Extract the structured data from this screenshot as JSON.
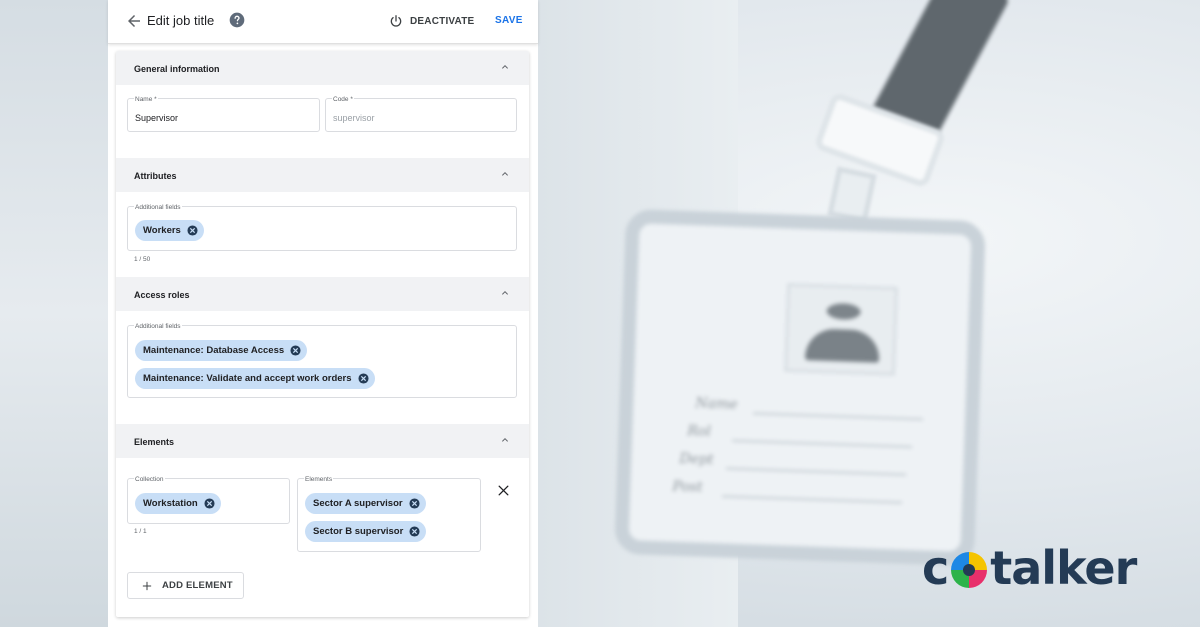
{
  "header": {
    "title": "Edit job title",
    "deactivate_label": "DEACTIVATE",
    "save_label": "SAVE"
  },
  "icons": {
    "back": "arrow-back-icon",
    "help": "help-icon",
    "power": "power-icon",
    "collapse": "chevron-up-icon",
    "chip_remove": "cancel-circle-icon",
    "close": "close-icon",
    "add": "plus-icon"
  },
  "colors": {
    "accent": "#1a73e8",
    "chip": "#c8def6",
    "section_header": "#f1f2f4",
    "logo_text": "#243b55"
  },
  "general": {
    "title": "General information",
    "name_label": "Name *",
    "name_value": "Supervisor",
    "code_label": "Code *",
    "code_placeholder": "supervisor"
  },
  "attributes": {
    "title": "Attributes",
    "field_label": "Additional fields",
    "chips": [
      "Workers"
    ],
    "counter": "1 / 50"
  },
  "access_roles": {
    "title": "Access roles",
    "field_label": "Additional fields",
    "chips": [
      "Maintenance: Database Access",
      "Maintenance: Validate and accept work orders"
    ]
  },
  "elements": {
    "title": "Elements",
    "collection_label": "Collection",
    "collection_chips": [
      "Workstation"
    ],
    "collection_counter": "1 / 1",
    "elements_label": "Elements",
    "elements_chips": [
      "Sector A supervisor",
      "Sector B supervisor"
    ],
    "add_label": "ADD ELEMENT"
  },
  "background": {
    "badge_lines": [
      "Name",
      "Rol",
      "Dept",
      "Post"
    ]
  },
  "logo": {
    "pre": "c",
    "post": "talker"
  }
}
